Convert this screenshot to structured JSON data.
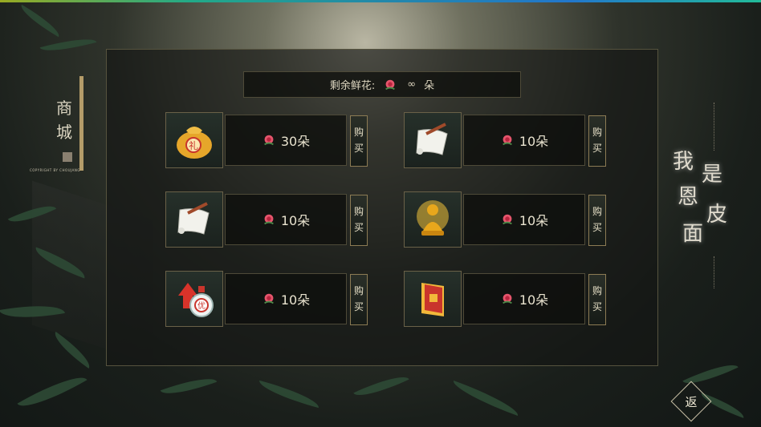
{
  "header": {
    "title_chars": [
      "商",
      "城"
    ],
    "copyright": "COPYRIGHT BY CHOUJANG"
  },
  "remaining": {
    "label": "剩余鲜花:",
    "value": "∞",
    "unit": "朵"
  },
  "items": [
    {
      "icon": "gift-bag-icon",
      "price": "30朵",
      "buy": [
        "购",
        "买"
      ]
    },
    {
      "icon": "scroll-icon",
      "price": "10朵",
      "buy": [
        "购",
        "买"
      ]
    },
    {
      "icon": "scroll-icon",
      "price": "10朵",
      "buy": [
        "购",
        "买"
      ]
    },
    {
      "icon": "golden-buddha-icon",
      "price": "10朵",
      "buy": [
        "购",
        "买"
      ]
    },
    {
      "icon": "potion-bottle-icon",
      "price": "10朵",
      "buy": [
        "购",
        "买"
      ]
    },
    {
      "icon": "red-book-icon",
      "price": "10朵",
      "buy": [
        "购",
        "买"
      ]
    }
  ],
  "logo": {
    "text": [
      "我",
      "是",
      "恩",
      "皮",
      "面"
    ]
  },
  "back": {
    "label": "返"
  },
  "colors": {
    "accent": "#b49c69",
    "flower": "#e5556c",
    "panel_border": "#56533e"
  }
}
